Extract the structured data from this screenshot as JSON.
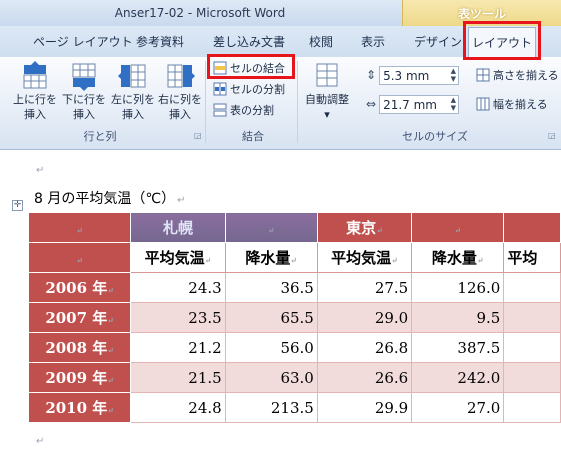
{
  "window": {
    "title": "Anser17-02 - Microsoft Word",
    "context_tab_group": "表ツール"
  },
  "tabs": [
    {
      "label": "ページ レイアウト"
    },
    {
      "label": "参考資料"
    },
    {
      "label": "差し込み文書"
    },
    {
      "label": "校閲"
    },
    {
      "label": "表示"
    },
    {
      "label": "デザイン"
    },
    {
      "label": "レイアウト"
    }
  ],
  "ribbon": {
    "rows_cols": {
      "group_label": "行と列",
      "insert_above_l1": "上に行を",
      "insert_above_l2": "挿入",
      "insert_below_l1": "下に行を",
      "insert_below_l2": "挿入",
      "insert_left_l1": "左に列を",
      "insert_left_l2": "挿入",
      "insert_right_l1": "右に列を",
      "insert_right_l2": "挿入"
    },
    "merge": {
      "group_label": "結合",
      "merge_cells": "セルの結合",
      "split_cells": "セルの分割",
      "split_table": "表の分割"
    },
    "cell_size": {
      "group_label": "セルのサイズ",
      "autofit": "自動調整",
      "height_value": "5.3 mm",
      "width_value": "21.7 mm",
      "distribute_rows": "高さを揃える",
      "distribute_cols": "幅を揃える"
    }
  },
  "document": {
    "caption": "8 月の平均気温（℃）",
    "para_mark": "↵",
    "cell_mark": "↵",
    "table": {
      "city_headers": [
        "札幌",
        "東京"
      ],
      "sub_headers": [
        "平均気温",
        "降水量",
        "平均気温",
        "降水量",
        "平均"
      ],
      "rows": [
        {
          "year": "2006 年",
          "values": [
            "24.3",
            "36.5",
            "27.5",
            "126.0"
          ]
        },
        {
          "year": "2007 年",
          "values": [
            "23.5",
            "65.5",
            "29.0",
            "9.5"
          ]
        },
        {
          "year": "2008 年",
          "values": [
            "21.2",
            "56.0",
            "26.8",
            "387.5"
          ]
        },
        {
          "year": "2009 年",
          "values": [
            "21.5",
            "63.0",
            "26.6",
            "242.0"
          ]
        },
        {
          "year": "2010 年",
          "values": [
            "24.8",
            "213.5",
            "29.9",
            "27.0"
          ]
        }
      ]
    }
  }
}
